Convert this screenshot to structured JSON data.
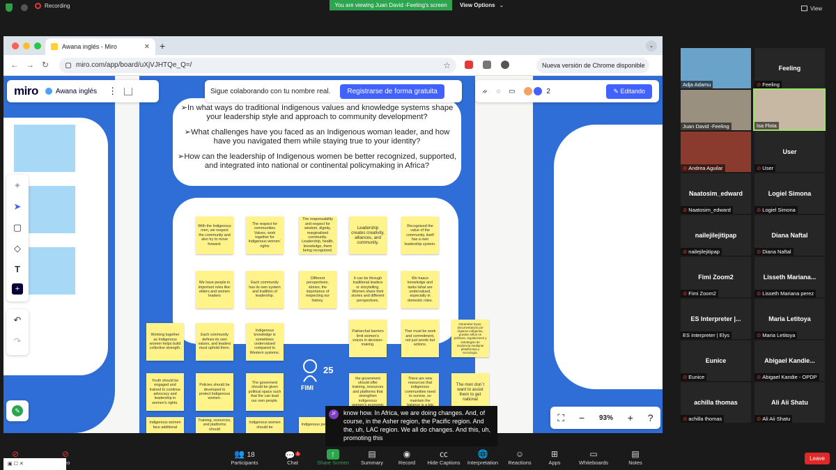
{
  "zoom": {
    "recording_label": "Recording",
    "viewing_banner": "You are viewing Juan David -Feeling's screen",
    "view_options_label": "View Options",
    "view_label": "View",
    "leave_label": "Leave"
  },
  "browser": {
    "tab_title": "Awana inglés - Miro",
    "url": "miro.com/app/board/uXjVJHTQe_Q=/",
    "update_label": "Nueva versión de Chrome disponible"
  },
  "miro": {
    "logo": "miro",
    "board_name": "Awana inglés",
    "collab_text": "Sigue colaborando con tu nombre real.",
    "register_label": "Registrarse de forma gratuita",
    "collaborator_count": "2",
    "edit_label": "Editando",
    "zoom_level": "93%",
    "questions": [
      "➢In what ways do traditional Indigenous values and knowledge systems shape your leadership style and approach to community development?",
      "➢What challenges have you faced as an Indigenous woman leader, and how have you navigated them while staying true to your identity?",
      "➢How can the leadership of Indigenous women be better recognized, supported, and integrated into national or continental policymaking in Africa?"
    ],
    "stickies": [
      "With the Indigenous men, we respect the community and also try to move forward.",
      "The respect for communities Values, work together for Indigenous women´ rights",
      "The responsability and respect for wisdom, dignity, marginalized community. Leadership, health, knowledge, them being recognized.",
      "Leadership creates creativity, alliances, and community.",
      "Recognized the value of the community, itself has a own leadership system.",
      "We have people in important roles like: elders and women leaders",
      "Each community has its own system and tradition of leadership.",
      "Different perspectives, stories, the importance of respecting our history.",
      "It can be through traditional leaders or storytelling. Women share their stories and different perspectives.",
      "We haace knowledge and tasks tahat are undervalued, especially in domestic roles.",
      "Working together as Indigenous women helps build collective strength.",
      "Each community defines its own values, and leaders must uphold them.",
      "Indigenous knowledge is sometimes undervalued compared to Western systems.",
      "Patriarchal barriers limit women's voices in decision-making.",
      "Ther must be work and commitment, not just words but actions.",
      "Garantizar leyes, documentación por órganos indígenas, pueden influir en políticas, regulaciones y estrategias de incidencia mediante plataformas y tecnología.",
      "Youth should be engaged and trained to continue advocacy and leadership in women's rights.",
      "Policies should be developed to protect Indigenous women.",
      "The goverment should be given political space such that the can lead our own people.",
      "the govenment should offer training, resources and platforms that strengthen indigenous women's economic",
      "There are new resources that indigenous communities need to survive, so maintain the balance is a big",
      "The men don´t want to assist them to get national",
      "Indigenous women face additional",
      "Training, resources, and platforms should",
      "Indigenous women should be",
      "Indigenous peoples"
    ],
    "fimi_label": "FIMI",
    "fimi_years": "25"
  },
  "caption": {
    "initials": "JF",
    "text": "know how. In Africa, we are doing changes. And, of course, in the Asher region, the Pacific region. And the, uh, LAC region. We all do changes. And this, uh, promoting this"
  },
  "participants": [
    {
      "tile": "",
      "label": "Adja Adamu",
      "muted": false
    },
    {
      "tile": "Feeling",
      "label": "Feeling",
      "muted": true
    },
    {
      "tile": "",
      "label": "Juan David -Feeling",
      "muted": false
    },
    {
      "tile": "",
      "label": "Isa Flota",
      "muted": false
    },
    {
      "tile": "",
      "label": "Andrea Aguilar",
      "muted": true
    },
    {
      "tile": "User",
      "label": "User",
      "muted": true
    },
    {
      "tile": "Naatosim_edward",
      "label": "Naatosim_edward",
      "muted": true
    },
    {
      "tile": "Logiel Simona",
      "label": "Logiel Simona",
      "muted": true
    },
    {
      "tile": "nailejilejitipap",
      "label": "nailejilejitipap",
      "muted": true
    },
    {
      "tile": "Diana Naftal",
      "label": "Diana Naftal",
      "muted": true
    },
    {
      "tile": "Fimi Zoom2",
      "label": "Fimi Zoom2",
      "muted": true
    },
    {
      "tile": "Lisseth  Mariana...",
      "label": "Lisseth Mariana perez",
      "muted": true
    },
    {
      "tile": "ES Interpreter |...",
      "label": "ES Interpreter | Elys",
      "muted": false
    },
    {
      "tile": "Maria Letitoya",
      "label": "Maria Letitoya",
      "muted": true
    },
    {
      "tile": "Eunice",
      "label": "Eunice",
      "muted": true
    },
    {
      "tile": "Abigael  Kandie...",
      "label": "Abigael Kandie - OPDP",
      "muted": true
    },
    {
      "tile": "achilla thomas",
      "label": "achilla thomas",
      "muted": true
    },
    {
      "tile": "Ali Aii Shatu",
      "label": "Ali Aii Shatu",
      "muted": true
    }
  ],
  "toolbar": {
    "participants_label": "Participants",
    "participants_count": "18",
    "chat_label": "Chat",
    "chat_badge": "1",
    "share_label": "Share Screen",
    "summary_label": "Summary",
    "record_label": "Record",
    "captions_label": "Hide Captions",
    "interpretation_label": "Interpretation",
    "reactions_label": "Reactions",
    "apps_label": "Apps",
    "whiteboards_label": "Whiteboards",
    "notes_label": "Notes",
    "video_label": "deo"
  }
}
